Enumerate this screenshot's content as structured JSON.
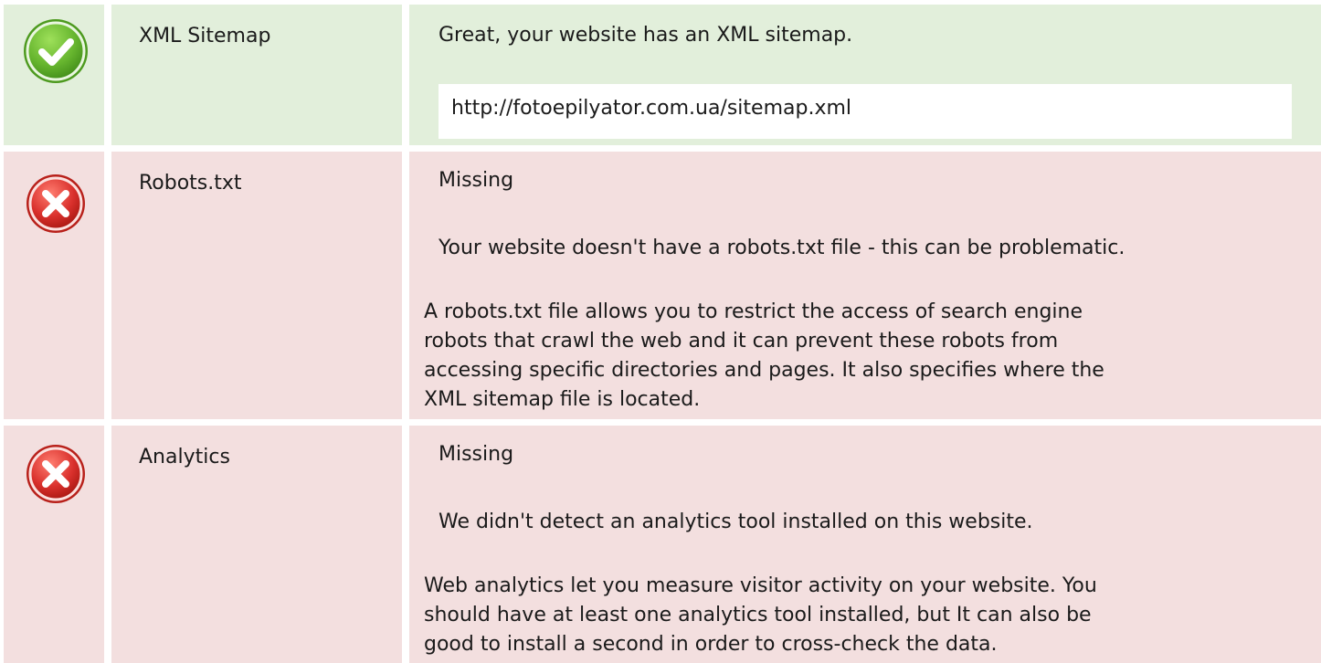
{
  "rows": [
    {
      "status": "pass",
      "icon": "check-circle-icon",
      "label": "XML Sitemap",
      "message": "Great, your website has an XML sitemap.",
      "url": "http://fotoepilyator.com.ua/sitemap.xml"
    },
    {
      "status": "fail",
      "icon": "error-x-icon",
      "label": "Robots.txt",
      "status_text": "Missing",
      "message": "Your website doesn't have a robots.txt file - this can be problematic.",
      "description_lines": [
        "A robots.txt file allows you to restrict the access of search engine",
        "robots that crawl the web and it can prevent these robots from",
        "accessing specific directories and pages. It also specifies where the",
        "XML sitemap file is located."
      ]
    },
    {
      "status": "fail",
      "icon": "error-x-icon",
      "label": "Analytics",
      "status_text": "Missing",
      "message": "We didn't detect an analytics tool installed on this website.",
      "description_lines": [
        "Web analytics let you measure visitor activity on your website. You",
        "should have at least one analytics tool installed, but It can also be",
        "good to install a second in order to cross-check the data."
      ]
    }
  ],
  "colors": {
    "pass_bg": "#e2efdb",
    "fail_bg": "#f3dfdf",
    "pass_icon": "#66b52e",
    "fail_icon": "#d9302c"
  }
}
